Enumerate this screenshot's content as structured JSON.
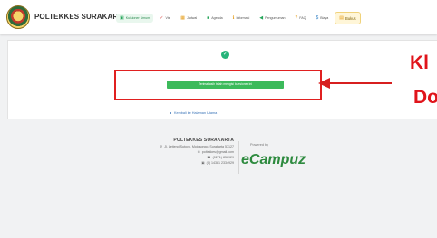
{
  "header": {
    "brand": "POLTEKKES SURAKARTA",
    "nav": [
      {
        "label": "Kuisioner Umum",
        "icon": "monitor-icon"
      },
      {
        "label": "Visi",
        "icon": "check-icon"
      },
      {
        "label": "Jadwal",
        "icon": "calendar-icon"
      },
      {
        "label": "Agenda",
        "icon": "briefcase-icon"
      },
      {
        "label": "Informasi",
        "icon": "info-icon"
      },
      {
        "label": "Pengumuman",
        "icon": "megaphone-icon"
      },
      {
        "label": "FAQ",
        "icon": "question-icon"
      },
      {
        "label": "Biaya",
        "icon": "money-icon"
      },
      {
        "label": "Bukus",
        "icon": "book-icon"
      }
    ]
  },
  "main": {
    "success_icon": "✓",
    "confirm_button": "Terimakasih telah mengisi kuesioner ini",
    "back_link": "Kembali ke Halaman Utama"
  },
  "annotation": {
    "line1": "Kl",
    "line2": "Do"
  },
  "footer": {
    "org": "POLTEKKES SURAKARTA",
    "address": "Jl. Letjend Sutoyo, Mojosongo, Surakarta 57127",
    "email": "poltekkes@gmail.com",
    "phone": "(0271) 856929",
    "fax": "(0) 14381 2334929",
    "powered_by": "Powered by",
    "vendor": "eCampuz"
  },
  "colors": {
    "accent": "#3cba5b",
    "annotation_red": "#e0141b",
    "link": "#3a74b8"
  }
}
